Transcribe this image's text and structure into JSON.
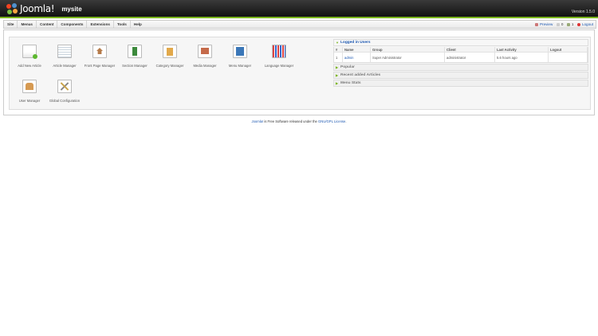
{
  "header": {
    "logo_text": "Joomla!",
    "site_name": "mysite",
    "version": "Version 1.5.0"
  },
  "menu": {
    "items": [
      "Site",
      "Menus",
      "Content",
      "Components",
      "Extensions",
      "Tools",
      "Help"
    ]
  },
  "status": {
    "preview": "Preview",
    "messages": "0",
    "users_online": "1",
    "logout": "Logout"
  },
  "cpanel": {
    "buttons": [
      {
        "label": "Add New Article",
        "icon": "add-article-icon"
      },
      {
        "label": "Article Manager",
        "icon": "article-manager-icon"
      },
      {
        "label": "Front Page Manager",
        "icon": "frontpage-icon"
      },
      {
        "label": "Section Manager",
        "icon": "section-icon"
      },
      {
        "label": "Category Manager",
        "icon": "category-icon"
      },
      {
        "label": "Media Manager",
        "icon": "media-icon"
      },
      {
        "label": "Menu Manager",
        "icon": "menu-icon"
      },
      {
        "label": "Language Manager",
        "icon": "language-icon"
      },
      {
        "label": "User Manager",
        "icon": "user-icon"
      },
      {
        "label": "Global Configuration",
        "icon": "config-icon"
      }
    ]
  },
  "panes": {
    "logged_in_title": "Logged in Users",
    "columns": [
      "#",
      "Name",
      "Group",
      "Client",
      "Last Activity",
      "Logout"
    ],
    "rows": [
      {
        "num": "1",
        "name": "admin",
        "group": "Super Administrator",
        "client": "administrator",
        "activity": "5.6 hours ago",
        "logout": ""
      }
    ],
    "popular_title": "Popular",
    "recent_title": "Recent added Articles",
    "menu_stats_title": "Menu Stats"
  },
  "footer": {
    "joomla": "Joomla!",
    "text": " is Free Software released under the ",
    "license": "GNU/GPL License",
    "end": "."
  }
}
